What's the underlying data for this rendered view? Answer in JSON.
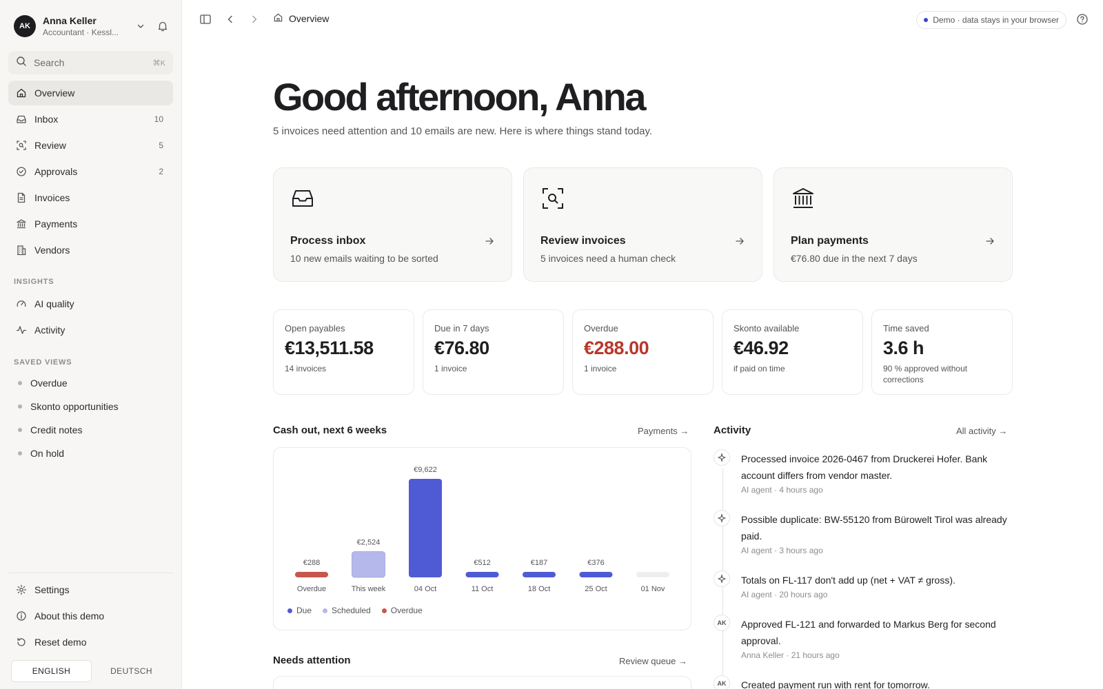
{
  "user": {
    "initials": "AK",
    "name": "Anna Keller",
    "role": "Accountant · Kessl..."
  },
  "search": {
    "placeholder": "Search",
    "shortcut": "⌘K"
  },
  "nav": [
    {
      "label": "Overview",
      "icon": "home-icon",
      "count": "",
      "active": true
    },
    {
      "label": "Inbox",
      "icon": "inbox-icon",
      "count": "10"
    },
    {
      "label": "Review",
      "icon": "scan-search-icon",
      "count": "5"
    },
    {
      "label": "Approvals",
      "icon": "check-circle-icon",
      "count": "2"
    },
    {
      "label": "Invoices",
      "icon": "file-icon",
      "count": ""
    },
    {
      "label": "Payments",
      "icon": "bank-icon",
      "count": ""
    },
    {
      "label": "Vendors",
      "icon": "building-icon",
      "count": ""
    }
  ],
  "insights": {
    "label": "INSIGHTS",
    "items": [
      {
        "label": "AI quality",
        "icon": "gauge-icon"
      },
      {
        "label": "Activity",
        "icon": "activity-icon"
      }
    ]
  },
  "saved_views": {
    "label": "SAVED VIEWS",
    "items": [
      "Overdue",
      "Skonto opportunities",
      "Credit notes",
      "On hold"
    ]
  },
  "bottom_nav": [
    {
      "label": "Settings",
      "icon": "gear-icon"
    },
    {
      "label": "About this demo",
      "icon": "info-icon"
    },
    {
      "label": "Reset demo",
      "icon": "reset-icon"
    }
  ],
  "languages": {
    "active": "ENGLISH",
    "other": "DEUTSCH"
  },
  "topbar": {
    "breadcrumb": "Overview",
    "demo_notice": "Demo · data stays in your browser"
  },
  "greeting": "Good afternoon, Anna",
  "subtitle": "5 invoices need attention and 10 emails are new. Here is where things stand today.",
  "action_cards": [
    {
      "title": "Process inbox",
      "desc": "10 new emails waiting to be sorted",
      "icon": "inbox-tray-icon"
    },
    {
      "title": "Review invoices",
      "desc": "5 invoices need a human check",
      "icon": "scan-search-icon"
    },
    {
      "title": "Plan payments",
      "desc": "€76.80 due in the next 7 days",
      "icon": "bank-icon"
    }
  ],
  "stats": [
    {
      "label": "Open payables",
      "value": "€13,511.58",
      "sub": "14 invoices"
    },
    {
      "label": "Due in 7 days",
      "value": "€76.80",
      "sub": "1 invoice"
    },
    {
      "label": "Overdue",
      "value": "€288.00",
      "sub": "1 invoice",
      "alert": true
    },
    {
      "label": "Skonto available",
      "value": "€46.92",
      "sub": "if paid on time"
    },
    {
      "label": "Time saved",
      "value": "3.6 h",
      "sub": "90 % approved without corrections"
    }
  ],
  "cash_section": {
    "title": "Cash out, next 6 weeks",
    "link": "Payments →"
  },
  "chart_data": {
    "type": "bar",
    "categories": [
      "Overdue",
      "This week",
      "04 Oct",
      "11 Oct",
      "18 Oct",
      "25 Oct",
      "01 Nov"
    ],
    "values": [
      288,
      2524,
      9622,
      512,
      187,
      376,
      0
    ],
    "labels": [
      "€288",
      "€2,524",
      "€9,622",
      "€512",
      "€187",
      "€376",
      ""
    ],
    "bar_kind": [
      "overdue",
      "scheduled",
      "due",
      "due",
      "due",
      "due",
      "empty"
    ],
    "legend": [
      "Due",
      "Scheduled",
      "Overdue"
    ],
    "colors": {
      "due": "#4f5bd5",
      "scheduled": "#b4b8ea",
      "overdue": "#c8564b",
      "empty": "#eeeeee"
    }
  },
  "activity_section": {
    "title": "Activity",
    "link": "All activity →"
  },
  "activity": [
    {
      "icon": "sparkle-icon",
      "text": "Processed invoice 2026-0467 from Druckerei Hofer. Bank account differs from vendor master.",
      "meta": "AI agent · 4 hours ago"
    },
    {
      "icon": "sparkle-icon",
      "text": "Possible duplicate: BW-55120 from Bürowelt Tirol was already paid.",
      "meta": "AI agent · 3 hours ago"
    },
    {
      "icon": "sparkle-icon",
      "text": "Totals on FL-117 don't add up (net + VAT ≠ gross).",
      "meta": "AI agent · 20 hours ago"
    },
    {
      "initials": "AK",
      "text": "Approved FL-121 and forwarded to Markus Berg for second approval.",
      "meta": "Anna Keller · 21 hours ago"
    },
    {
      "initials": "AK",
      "text": "Created payment run with rent for tomorrow.",
      "meta": ""
    }
  ],
  "attention_section": {
    "title": "Needs attention",
    "link": "Review queue →"
  }
}
